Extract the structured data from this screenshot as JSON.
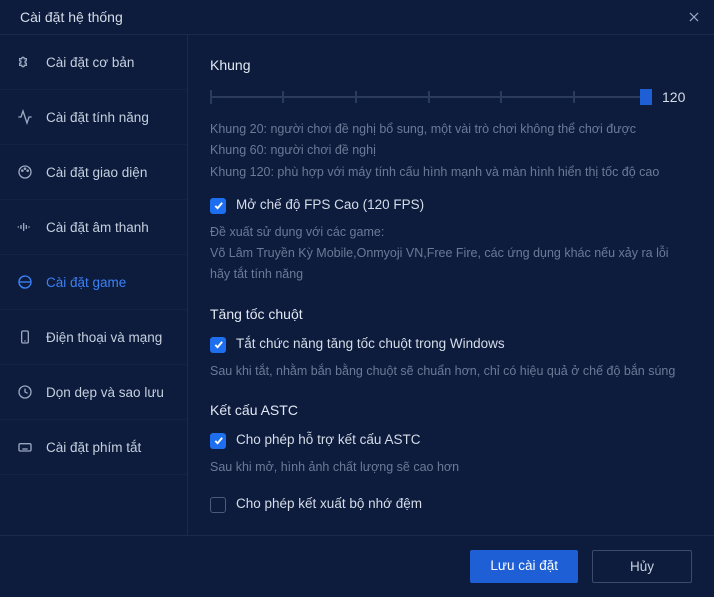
{
  "window": {
    "title": "Cài đặt hệ thống"
  },
  "sidebar": {
    "items": [
      {
        "label": "Cài đặt cơ bản"
      },
      {
        "label": "Cài đặt tính năng"
      },
      {
        "label": "Cài đặt giao diện"
      },
      {
        "label": "Cài đặt âm thanh"
      },
      {
        "label": "Cài đặt game"
      },
      {
        "label": "Điện thoại và mạng"
      },
      {
        "label": "Dọn dẹp và sao lưu"
      },
      {
        "label": "Cài đặt phím tắt"
      }
    ]
  },
  "frame": {
    "heading": "Khung",
    "value": "120",
    "hint1": "Khung 20: người chơi đề nghị bổ sung, một vài trò chơi không thể chơi được",
    "hint2": "Khung 60: người chơi đề nghị",
    "hint3": "Khung 120: phù hợp với máy tính cấu hình mạnh và màn hình hiển thị tốc độ cao",
    "fps_checkbox_label": "Mở chế độ FPS Cao (120 FPS)",
    "fps_hint_title": "Đề xuất sử dụng với các game:",
    "fps_hint_body": "Võ Lâm Truyền Kỳ Mobile,Onmyoji VN,Free Fire, các ứng dụng khác nếu xảy ra lỗi hãy tắt tính năng"
  },
  "mouse": {
    "heading": "Tăng tốc chuột",
    "checkbox_label": "Tắt chức năng tăng tốc chuột trong Windows",
    "hint": "Sau khi tắt, nhằm bắn bằng chuột sẽ chuẩn hơn, chỉ có hiệu quả ở chế độ bắn súng"
  },
  "astc": {
    "heading": "Kết cấu ASTC",
    "checkbox_label": "Cho phép hỗ trợ kết cấu ASTC",
    "hint": "Sau khi mở, hình ảnh chất lượng sẽ cao hơn",
    "cache_label": "Cho phép kết xuất bộ nhớ đệm"
  },
  "footer": {
    "save": "Lưu cài đặt",
    "cancel": "Hủy"
  }
}
